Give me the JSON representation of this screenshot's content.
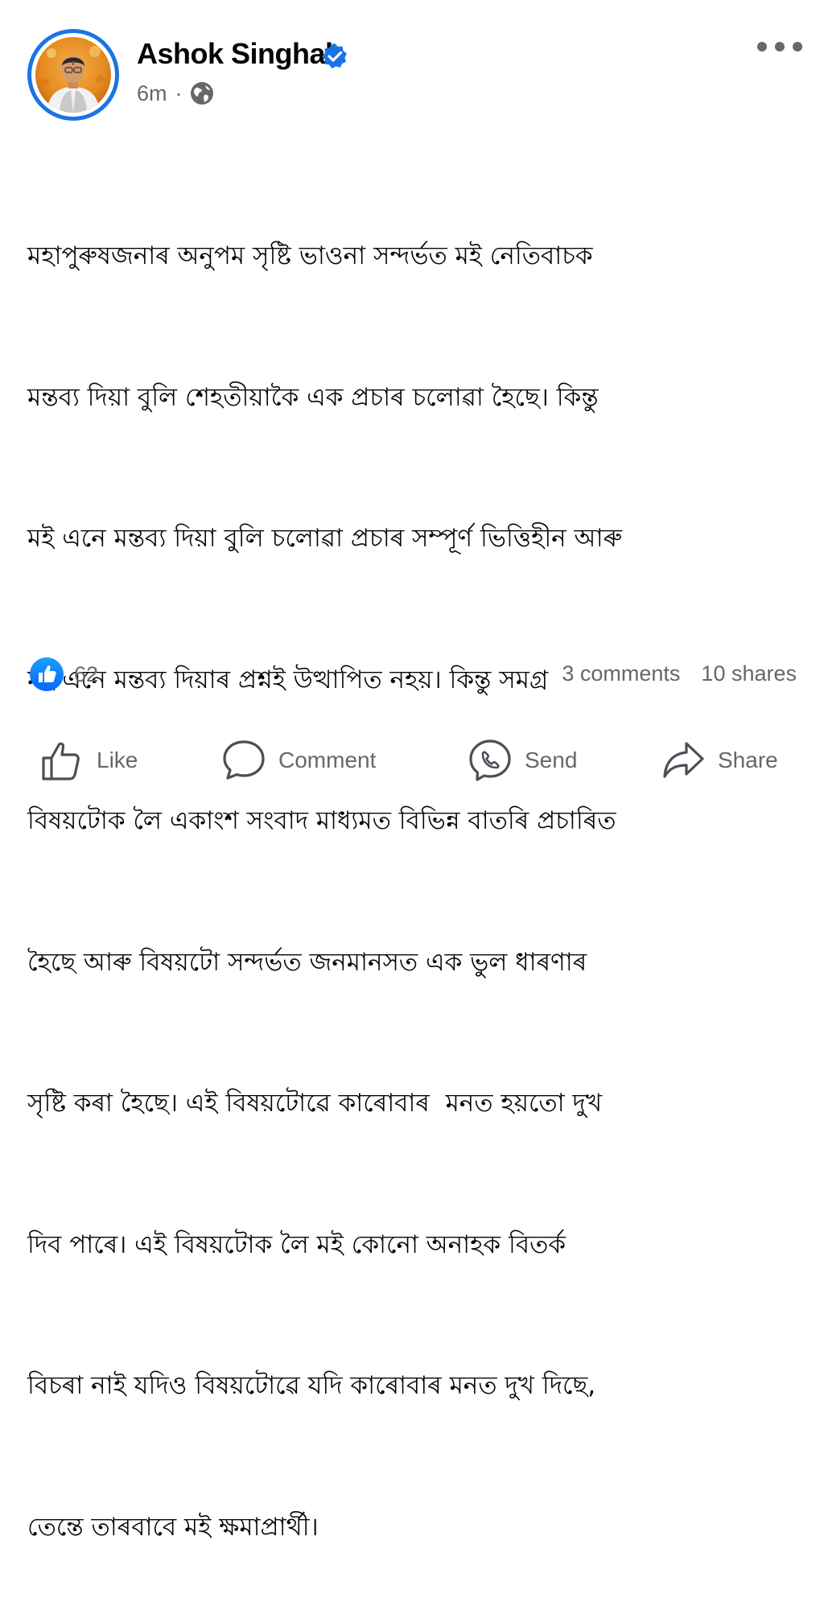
{
  "post": {
    "author_name": "Ashok Singhal",
    "timestamp": "6m",
    "separator": "·",
    "privacy_icon": "globe-icon",
    "verified_icon": "verified-badge-icon",
    "more_icon": "more-options-icon",
    "body_lines": [
      "মহাপুৰুষজনাৰ অনুপম সৃষ্টি ভাওনা সন্দৰ্ভত মই নেতিবাচক",
      "মন্তব্য দিয়া বুলি শেহতীয়াকৈ এক প্ৰচাৰ চলোৱা হৈছে। কিন্তু",
      "মই এনে মন্তব্য দিয়া বুলি চলোৱা প্ৰচাৰ সম্পূৰ্ণ ভিত্তিহীন আৰু",
      "মই এনে মন্তব্য দিয়াৰ প্ৰশ্নই উত্থাপিত নহয়। কিন্তু সমগ্ৰ",
      "বিষয়টোক লৈ একাংশ সংবাদ মাধ্যমত বিভিন্ন বাতৰি প্ৰচাৰিত",
      "হৈছে আৰু বিষয়টো সন্দৰ্ভত জনমানসত এক ভুল ধাৰণাৰ",
      "সৃষ্টি কৰা হৈছে। এই বিষয়টোৱে কাৰোবাৰ  মনত হয়তো দুখ",
      "দিব পাৰে। এই বিষয়টোক লৈ মই কোনো অনাহক বিতৰ্ক",
      "বিচৰা নাই যদিও বিষয়টোৱে যদি কাৰোবাৰ মনত দুখ দিছে,",
      "তেন্তে তাৰবাবে মই ক্ষমাপ্ৰাৰ্থী।"
    ]
  },
  "stats": {
    "reaction_icon": "like-reaction-icon",
    "reaction_count": "62",
    "comments": "3 comments",
    "shares": "10 shares"
  },
  "actions": {
    "like": {
      "label": "Like",
      "icon": "thumbs-up-icon"
    },
    "comment": {
      "label": "Comment",
      "icon": "comment-bubble-icon"
    },
    "send": {
      "label": "Send",
      "icon": "messenger-icon"
    },
    "share": {
      "label": "Share",
      "icon": "share-arrow-icon"
    }
  },
  "colors": {
    "accent": "#1b74e4",
    "secondary_text": "#65676b",
    "primary_text": "#050505"
  }
}
